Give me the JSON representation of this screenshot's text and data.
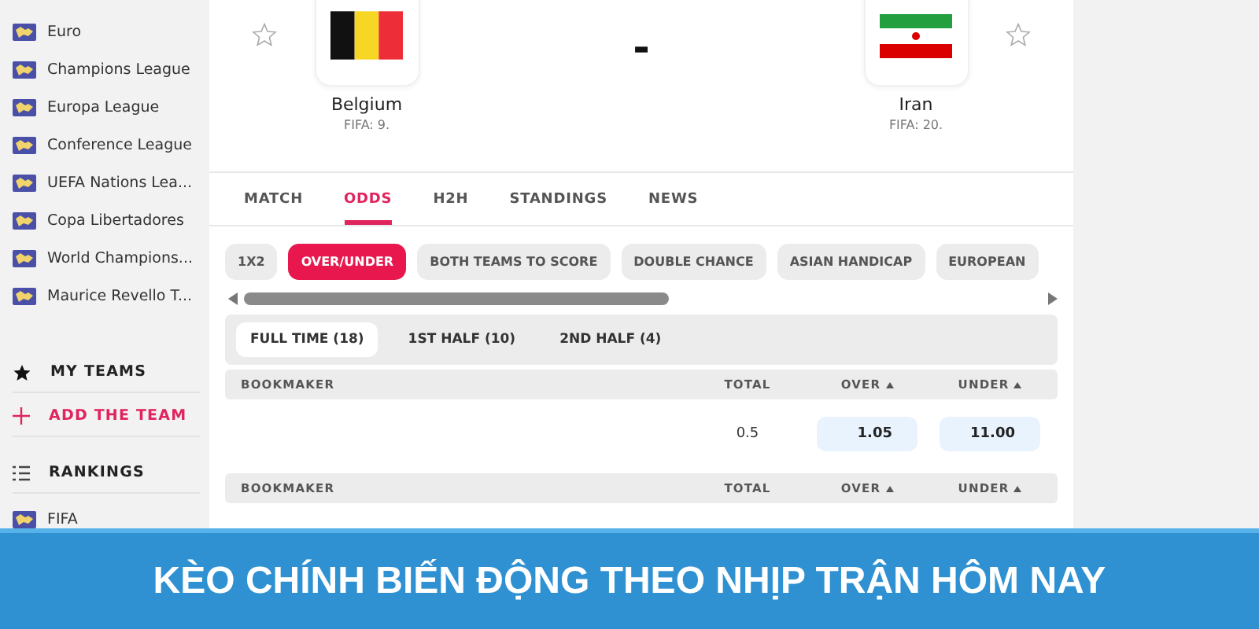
{
  "sidebar": {
    "leagues": [
      "Euro",
      "Champions League",
      "Europa League",
      "Conference League",
      "UEFA Nations Lea...",
      "Copa Libertadores",
      "World Champions...",
      "Maurice Revello T..."
    ],
    "my_teams": "MY TEAMS",
    "add_team": "ADD THE TEAM",
    "rankings": "RANKINGS",
    "ranking_items": [
      "FIFA"
    ]
  },
  "match": {
    "teams": [
      {
        "kind": "belgium",
        "name": "Belgium",
        "fifa": "FIFA: 9.",
        "favorite": false
      },
      {
        "kind": "iran",
        "name": "Iran",
        "fifa": "FIFA: 20.",
        "favorite": false
      }
    ],
    "score": "-"
  },
  "tabs": [
    {
      "label": "MATCH",
      "selected": false
    },
    {
      "label": "ODDS",
      "selected": true
    },
    {
      "label": "H2H",
      "selected": false
    },
    {
      "label": "STANDINGS",
      "selected": false
    },
    {
      "label": "NEWS",
      "selected": false
    }
  ],
  "markets": [
    {
      "label": "1X2",
      "selected": false
    },
    {
      "label": "OVER/UNDER",
      "selected": true
    },
    {
      "label": "BOTH TEAMS TO SCORE",
      "selected": false
    },
    {
      "label": "DOUBLE CHANCE",
      "selected": false
    },
    {
      "label": "ASIAN HANDICAP",
      "selected": false
    },
    {
      "label": "EUROPEAN",
      "selected": false
    }
  ],
  "periods": [
    {
      "label": "FULL TIME (18)",
      "selected": true
    },
    {
      "label": "1ST HALF (10)",
      "selected": false
    },
    {
      "label": "2ND HALF (4)",
      "selected": false
    }
  ],
  "tables": [
    {
      "columns": [
        {
          "label": "BOOKMAKER",
          "sortable": false
        },
        {
          "label": "TOTAL",
          "sortable": false
        },
        {
          "label": "OVER",
          "sortable": true
        },
        {
          "label": "UNDER",
          "sortable": true
        }
      ],
      "rows": [
        {
          "total": "0.5",
          "over": "1.05",
          "under": "11.00"
        }
      ]
    },
    {
      "columns": [
        {
          "label": "BOOKMAKER",
          "sortable": false
        },
        {
          "label": "TOTAL",
          "sortable": false
        },
        {
          "label": "OVER",
          "sortable": true
        },
        {
          "label": "UNDER",
          "sortable": true
        }
      ]
    }
  ],
  "banner": {
    "text": "KÈO CHÍNH BIẾN ĐỘNG THEO NHỊP TRẬN HÔM NAY"
  }
}
